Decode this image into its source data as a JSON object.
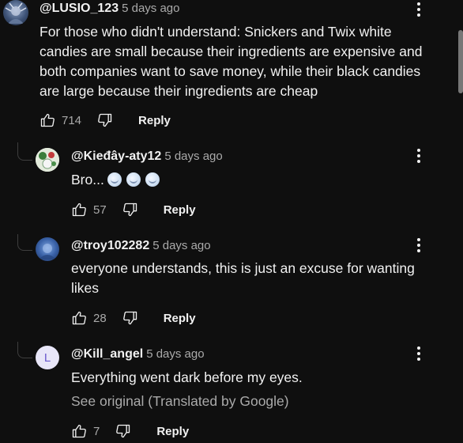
{
  "comments": [
    {
      "author": "@LUSIO_123",
      "time": "5 days ago",
      "text": "For those who didn't understand: Snickers and Twix white candies are small because their ingredients are expensive and both companies want to save money, while their black candies are large because their ingredients are cheap",
      "likes": "714",
      "reply_label": "Reply"
    },
    {
      "author": "@Kieđây-aty12",
      "time": "5 days ago",
      "text": "Bro...",
      "emojis": [
        "cold-face-emoji",
        "cold-face-emoji",
        "cold-face-emoji"
      ],
      "likes": "57",
      "reply_label": "Reply"
    },
    {
      "author": "@troy102282",
      "time": "5 days ago",
      "text": "everyone understands, this is just an excuse for wanting likes",
      "likes": "28",
      "reply_label": "Reply"
    },
    {
      "author": "@Kill_angel",
      "time": "5 days ago",
      "avatar_letter": "L",
      "text": "Everything went dark before my eyes.",
      "translation_note": "See original (Translated by Google)",
      "likes": "7",
      "reply_label": "Reply"
    }
  ],
  "icons": {
    "like": "thumbs-up-icon",
    "dislike": "thumbs-down-icon",
    "menu": "more-vert-icon"
  },
  "colors": {
    "background": "#0f0f0f",
    "text": "#f1f1f1",
    "secondary": "#aaaaaa",
    "letter_avatar_bg": "#e8e6f8",
    "letter_avatar_fg": "#6a5acd"
  }
}
